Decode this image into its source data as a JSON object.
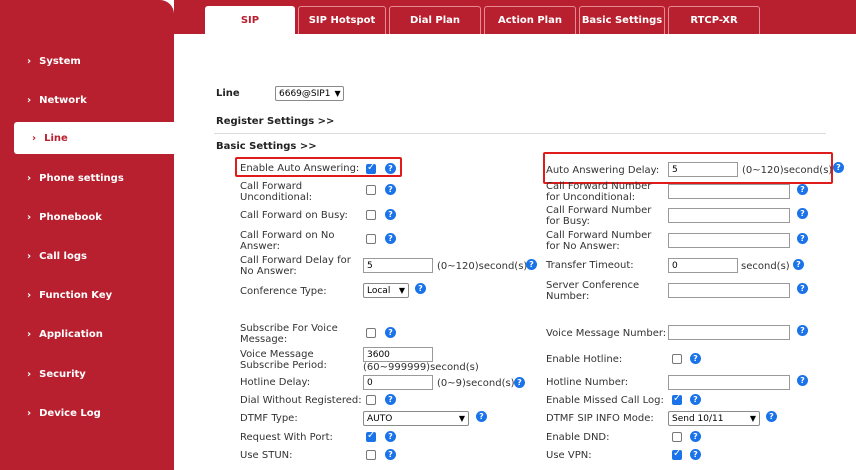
{
  "sidebar": {
    "items": [
      {
        "label": "System"
      },
      {
        "label": "Network"
      },
      {
        "label": "Line"
      },
      {
        "label": "Phone settings"
      },
      {
        "label": "Phonebook"
      },
      {
        "label": "Call logs"
      },
      {
        "label": "Function Key"
      },
      {
        "label": "Application"
      },
      {
        "label": "Security"
      },
      {
        "label": "Device Log"
      }
    ],
    "chevron": "›"
  },
  "tabs": [
    {
      "label": "SIP"
    },
    {
      "label": "SIP Hotspot"
    },
    {
      "label": "Dial Plan"
    },
    {
      "label": "Action Plan"
    },
    {
      "label": "Basic Settings"
    },
    {
      "label": "RTCP-XR"
    }
  ],
  "line": {
    "label": "Line",
    "value": "6669@SIP1"
  },
  "sections": {
    "register": "Register Settings >>",
    "basic": "Basic Settings >>"
  },
  "fields": {
    "enable_auto_answering": "Enable Auto Answering:",
    "auto_answering_delay": "Auto Answering Delay:",
    "auto_answering_delay_value": "5",
    "auto_answering_delay_unit": "(0~120)second(s)",
    "cf_unconditional": "Call Forward Unconditional:",
    "cf_number_unconditional": "Call Forward Number for Unconditional:",
    "cf_busy": "Call Forward on Busy:",
    "cf_number_busy": "Call Forward Number for Busy:",
    "cf_no_answer": "Call Forward on No Answer:",
    "cf_number_no_answer": "Call Forward Number for No Answer:",
    "cf_delay_no_answer": "Call Forward Delay for No Answer:",
    "cf_delay_value": "5",
    "cf_delay_unit": "(0~120)second(s)",
    "transfer_timeout": "Transfer Timeout:",
    "transfer_timeout_value": "0",
    "transfer_timeout_unit": "second(s)",
    "conference_type": "Conference Type:",
    "conference_type_value": "Local",
    "server_conference_number": "Server Conference Number:",
    "subscribe_voice_message": "Subscribe For Voice Message:",
    "voice_message_number": "Voice Message Number:",
    "vm_subscribe_period": "Voice Message Subscribe Period:",
    "vm_subscribe_period_value": "3600",
    "vm_subscribe_period_unit": "(60~999999)second(s)",
    "enable_hotline": "Enable Hotline:",
    "hotline_delay": "Hotline Delay:",
    "hotline_delay_value": "0",
    "hotline_delay_unit": "(0~9)second(s)",
    "hotline_number": "Hotline Number:",
    "dial_without_registered": "Dial Without Registered:",
    "enable_missed_call_log": "Enable Missed Call Log:",
    "dtmf_type": "DTMF Type:",
    "dtmf_type_value": "AUTO",
    "dtmf_sip_info_mode": "DTMF SIP INFO Mode:",
    "dtmf_sip_info_mode_value": "Send 10/11",
    "request_with_port": "Request With Port:",
    "enable_dnd": "Enable DND:",
    "use_stun": "Use STUN:",
    "use_vpn": "Use VPN:"
  },
  "help_glyph": "?",
  "colors": {
    "brand": "#b8202f",
    "accent": "#1a73e8",
    "highlight": "#e01b1b"
  }
}
